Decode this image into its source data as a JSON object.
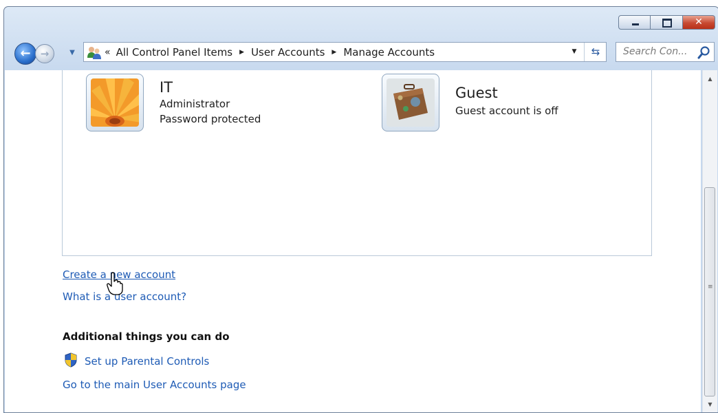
{
  "window": {
    "controls": {
      "minimize": "",
      "maximize": "",
      "close": "✕"
    }
  },
  "navigation": {
    "back_icon": "back-arrow-icon",
    "forward_icon": "forward-arrow-icon",
    "address": {
      "overflow": "«",
      "crumbs": [
        "All Control Panel Items",
        "User Accounts",
        "Manage Accounts"
      ]
    },
    "search_placeholder": "Search Con..."
  },
  "accounts": [
    {
      "name": "IT",
      "lines": [
        "Administrator",
        "Password protected"
      ],
      "picture": "flower"
    },
    {
      "name": "Guest",
      "lines": [
        "Guest account is off"
      ],
      "picture": "suitcase"
    }
  ],
  "links": {
    "create_account": "Create a new account",
    "what_is": "What is a user account?"
  },
  "additional": {
    "heading": "Additional things you can do",
    "parental_controls": "Set up Parental Controls",
    "main_page": "Go to the main User Accounts page"
  },
  "colors": {
    "link": "#1e5bb5",
    "close_button": "#c74a32"
  }
}
